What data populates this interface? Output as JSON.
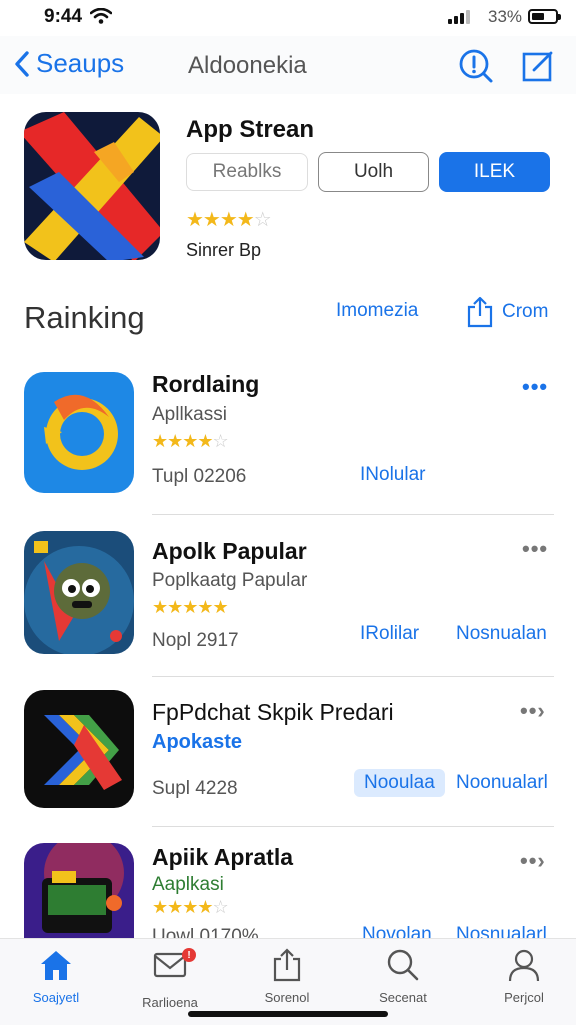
{
  "status": {
    "time": "9:44",
    "battery": "33%"
  },
  "nav": {
    "back_label": "Seaups",
    "title": "Aldoonekia"
  },
  "hero": {
    "name": "App Strean",
    "buttons": {
      "ratings": "Reablks",
      "secondary": "Uolh",
      "primary": "ILEK"
    },
    "stars": "★★★★",
    "stars_empty": "☆",
    "subtitle": "Sinrer Bp"
  },
  "section": {
    "title": "Rainking",
    "link": "Imomezia",
    "share_label": "Crom"
  },
  "apps": [
    {
      "name": "Rordlaing",
      "subtitle": "Apllkassi",
      "stars": "★★★★",
      "stars_empty": "☆",
      "meta": "Tupl 02206",
      "action1": "INolular",
      "action2": "",
      "more": "•••"
    },
    {
      "name": "Apolk Papular",
      "subtitle": "Poplkaatg Papular",
      "stars": "★★★★★",
      "stars_empty": "",
      "meta": "Nopl 2917",
      "action1": "IRolilar",
      "action2": "Nosnualan",
      "more": "•••"
    },
    {
      "name": "FpPdchat Skpik Predari",
      "subtitle": "Apokaste",
      "stars": "",
      "stars_empty": "",
      "meta": "Supl 4228",
      "action1": "Nooulaa",
      "action2": "Noonualarl",
      "more": "••›"
    },
    {
      "name": "Apiik Apratla",
      "subtitle": "Aaplkasi",
      "stars": "★★★★",
      "stars_empty": "☆",
      "meta": "Uowl 0170%",
      "action1": "Novolan",
      "action2": "Nosnualarl",
      "more": "••›"
    }
  ],
  "tabs": [
    {
      "label": "Soajyetl",
      "icon": "home-icon",
      "active": true
    },
    {
      "label": "Rarlioena",
      "icon": "mail-icon",
      "badge": "!"
    },
    {
      "label": "Sorenol",
      "icon": "share-icon"
    },
    {
      "label": "Secenat",
      "icon": "search-icon"
    },
    {
      "label": "Perjcol",
      "icon": "person-icon"
    }
  ],
  "colors": {
    "accent": "#1a73e8",
    "star": "#f3b81a",
    "badge": "#e53935"
  }
}
